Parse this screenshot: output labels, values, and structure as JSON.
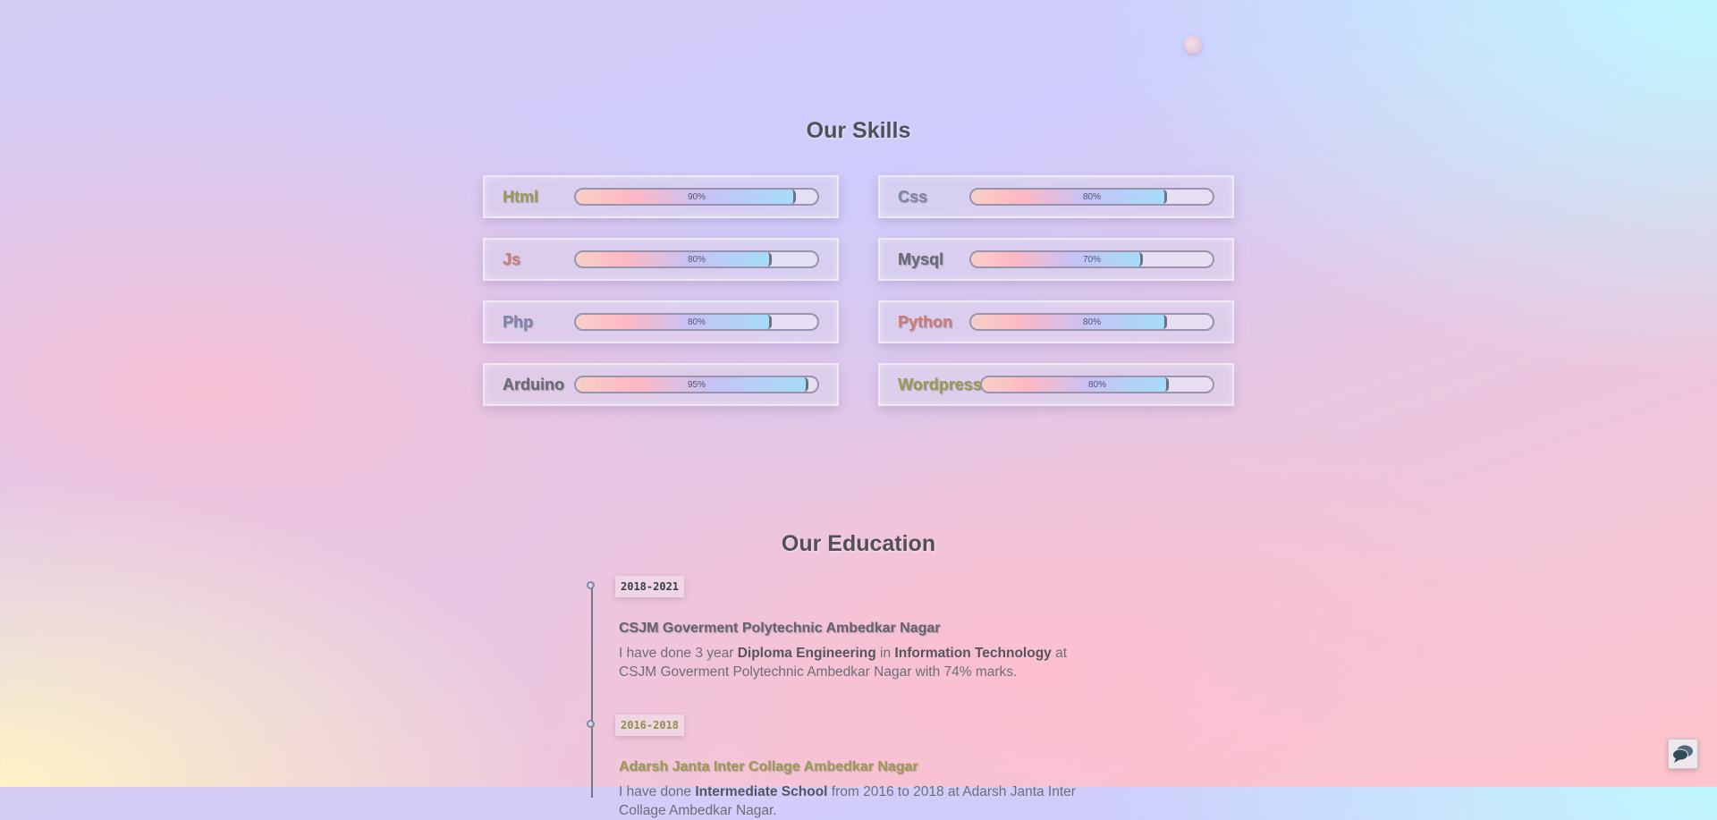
{
  "colors": {
    "accent_olive": "#9a9a52",
    "accent_slate": "#7e84a8",
    "accent_coral": "#d07a78",
    "accent_gray": "#686872"
  },
  "skills": {
    "title": "Our Skills",
    "items": [
      {
        "name": "Html",
        "percent": 90,
        "label": "90%",
        "color": "#9a9a52"
      },
      {
        "name": "Css",
        "percent": 80,
        "label": "80%",
        "color": "#7e84a8"
      },
      {
        "name": "Js",
        "percent": 80,
        "label": "80%",
        "color": "#d07a78"
      },
      {
        "name": "Mysql",
        "percent": 70,
        "label": "70%",
        "color": "#686872"
      },
      {
        "name": "Php",
        "percent": 80,
        "label": "80%",
        "color": "#7e84a8"
      },
      {
        "name": "Python",
        "percent": 80,
        "label": "80%",
        "color": "#d07a78"
      },
      {
        "name": "Arduino",
        "percent": 95,
        "label": "95%",
        "color": "#686872"
      },
      {
        "name": "Wordpress",
        "percent": 80,
        "label": "80%",
        "color": "#9a9a52"
      }
    ]
  },
  "education": {
    "title": "Our Education",
    "items": [
      {
        "year": "2018-2021",
        "year_color": "#3c3c44",
        "title": "CSJM Goverment Polytechnic Ambedkar Nagar",
        "title_color": "#626270",
        "desc_html": "I have done 3 year <b>Diploma Engineering</b> in <b>Information Technology</b> at CSJM Goverment Polytechnic Ambedkar Nagar with 74% marks."
      },
      {
        "year": "2016-2018",
        "year_color": "#8f8f4a",
        "title": "Adarsh Janta Inter Collage Ambedkar Nagar",
        "title_color": "#9a9a52",
        "desc_html": "I have done <b>Intermediate School</b> from 2016 to 2018 at Adarsh Janta Inter Collage Ambedkar Nagar."
      }
    ]
  },
  "chat": {
    "icon": "chat-bubbles-icon"
  }
}
